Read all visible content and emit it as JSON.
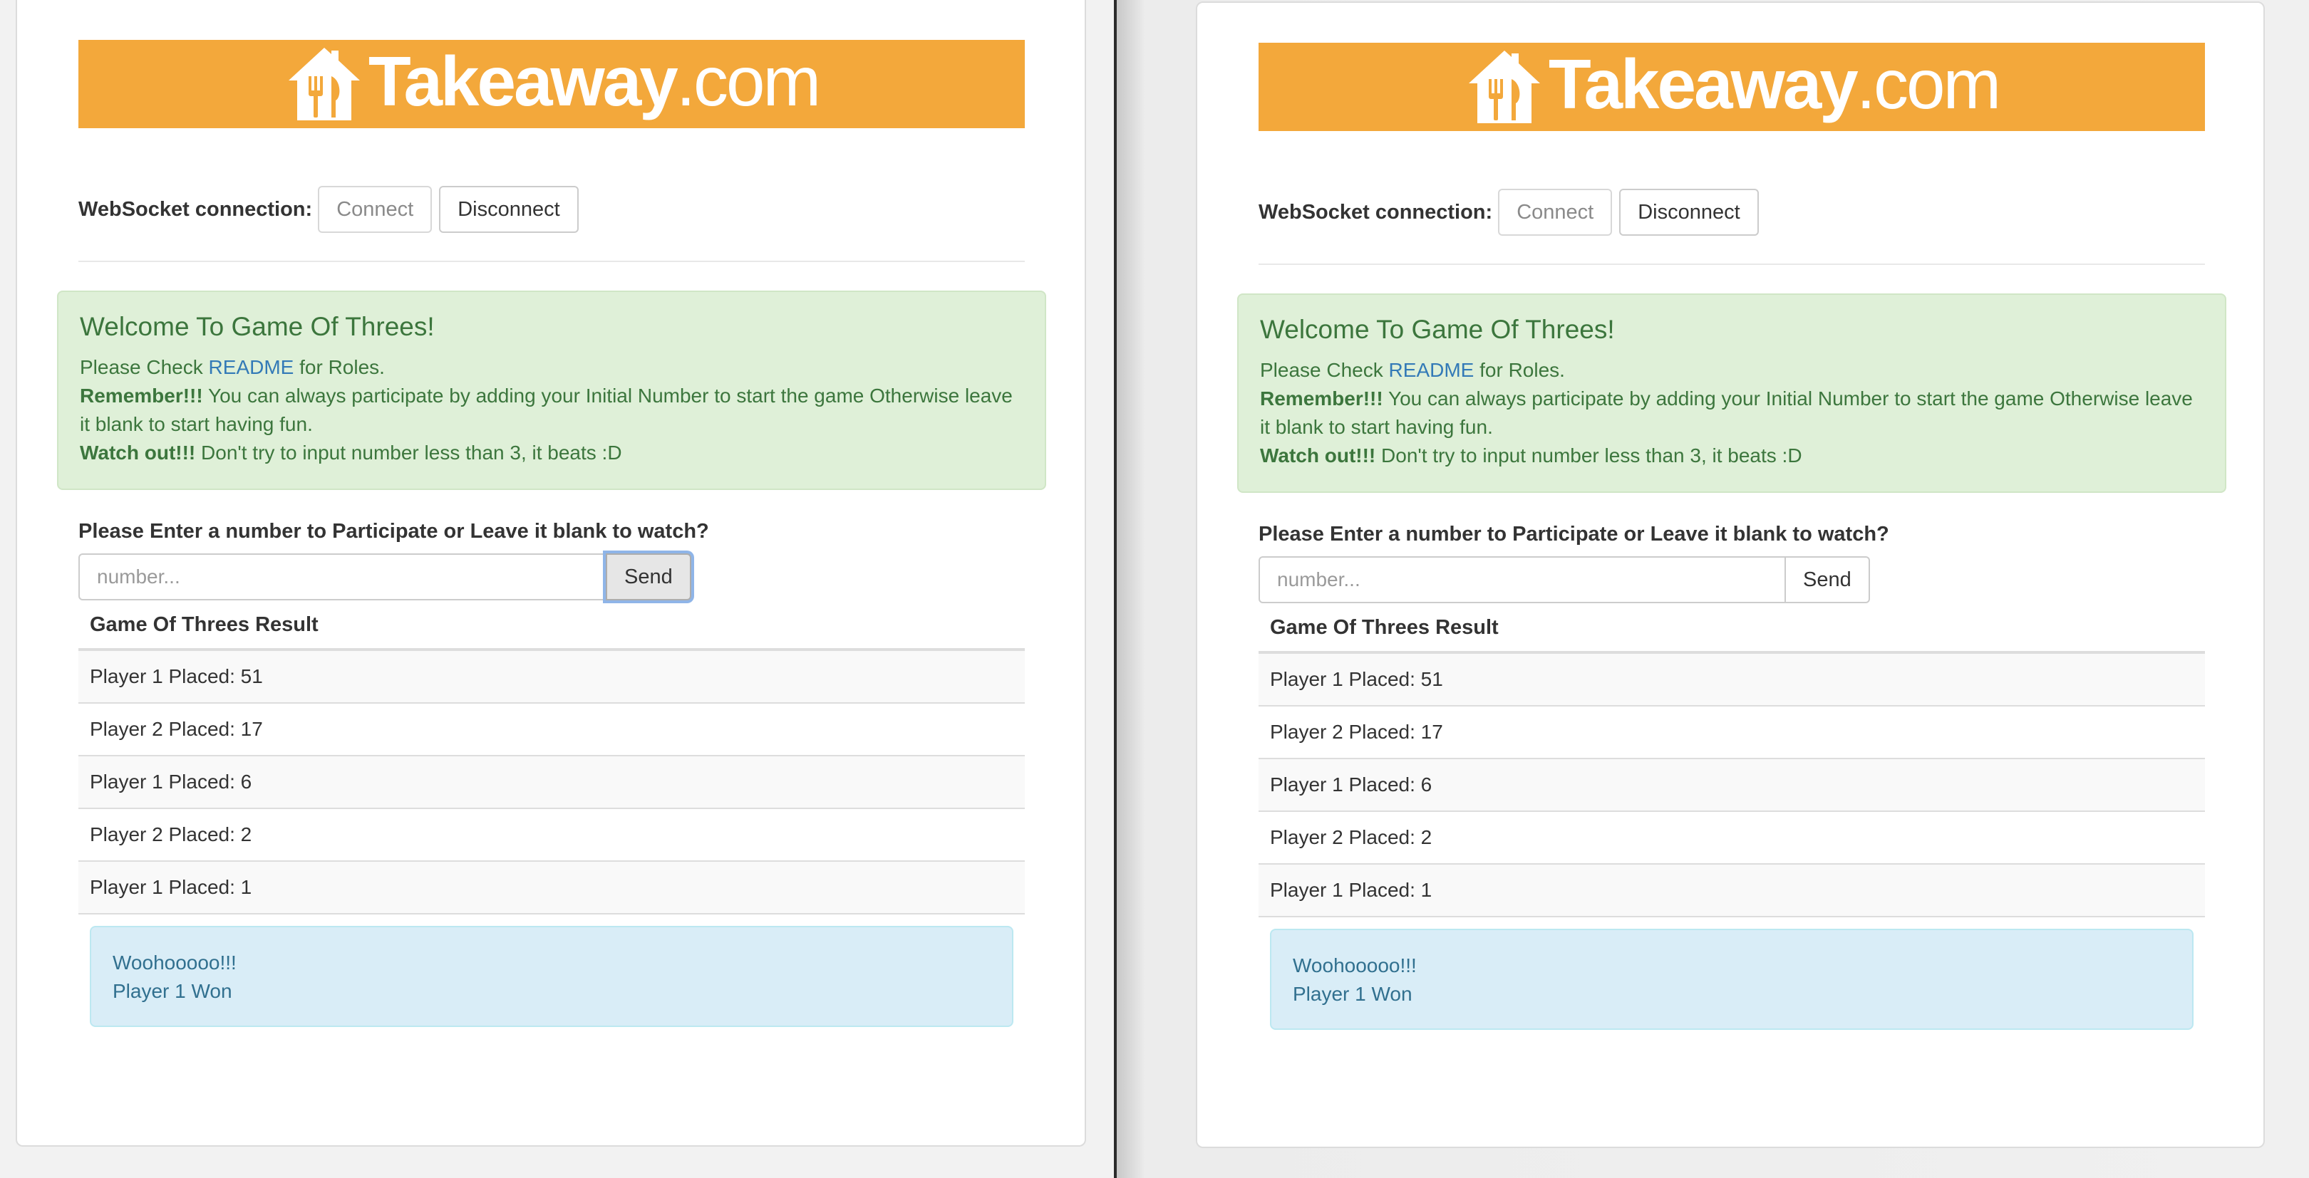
{
  "brand": {
    "name_bold": "Takeaway",
    "name_light": ".com",
    "color": "#f3a83b",
    "icon": "takeaway-house-fork-knife-icon"
  },
  "websocket": {
    "label": "WebSocket connection:",
    "connect_label": "Connect",
    "disconnect_label": "Disconnect"
  },
  "welcome": {
    "title": "Welcome To Game Of Threes!",
    "check_prefix": "Please Check ",
    "readme_link": "README",
    "check_suffix": " for Roles.",
    "remember_bold": "Remember!!!",
    "remember_text": " You can always participate by adding your Initial Number to start the game Otherwise leave it blank to start having fun.",
    "watch_bold": "Watch out!!!",
    "watch_text": " Don't try to input number less than 3, it beats :D"
  },
  "participate": {
    "label": "Please Enter a number to Participate or Leave it blank to watch?",
    "placeholder": "number...",
    "value": "",
    "send_label": "Send"
  },
  "results": {
    "header": "Game Of Threes Result",
    "rows": [
      "Player 1 Placed: 51",
      "Player 2 Placed: 17",
      "Player 1 Placed: 6",
      "Player 2 Placed: 2",
      "Player 1 Placed: 1"
    ],
    "outcome_line1": "Woohooooo!!!",
    "outcome_line2": "Player 1 Won"
  }
}
